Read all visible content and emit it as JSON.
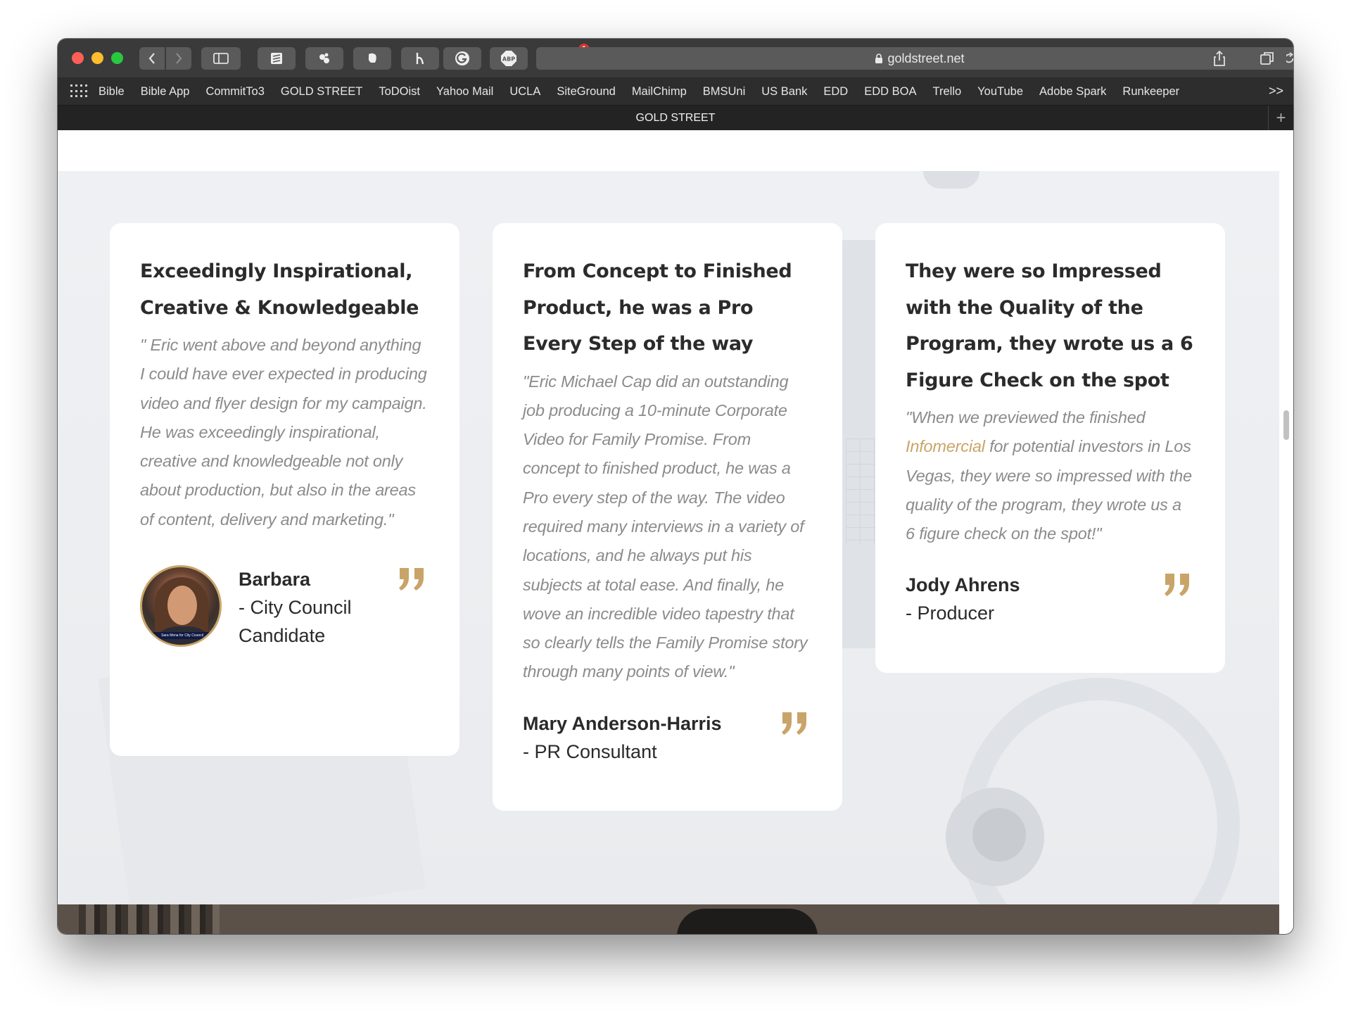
{
  "browser": {
    "url": "goldstreet.net",
    "tab_title": "GOLD STREET",
    "adblock_count": "1",
    "bookmarks": [
      "Bible",
      "Bible App",
      "CommitTo3",
      "GOLD STREET",
      "ToDOist",
      "Yahoo Mail",
      "UCLA",
      "SiteGround",
      "MailChimp",
      "BMSUni",
      "US Bank",
      "EDD",
      "EDD BOA",
      "Trello",
      "YouTube",
      "Adobe Spark",
      "Runkeeper"
    ],
    "more_label": ">>",
    "new_tab_label": "+"
  },
  "testimonials": [
    {
      "title": "Exceedingly Inspirational, Creative & Knowledgeable",
      "quote": "\" Eric went above and beyond anything I could have ever expected in producing video and flyer design for my campaign. He was exceedingly inspirational, creative and knowledgeable not only about production, but also in the areas of content, delivery and marketing.\"",
      "name": "Barbara",
      "role": "- City Council Candidate",
      "avatar_caption": "Sara Mena for City Council"
    },
    {
      "title": "From Concept to Finished Product, he was a Pro Every Step of the way",
      "quote": "\"Eric Michael Cap did an outstanding job producing a 10-minute Corporate Video for Family Promise. From concept to finished product, he was a Pro every step of the way. The video required many interviews in a variety of locations, and he always put his subjects at total ease. And finally, he wove an incredible video tapestry that so clearly tells the Family Promise story through many points of view.\"",
      "name": "Mary Anderson-Harris",
      "role": "- PR Consultant"
    },
    {
      "title": "They were so Impressed with the Quality of the Program, they wrote us a 6 Figure Check on the spot",
      "quote_before": "\"When we previewed the finished ",
      "quote_link": "Infomercial",
      "quote_after": " for potential investors in Los Vegas, they were so impressed with the quality of the program, they wrote us a 6 figure check on the spot!\"",
      "name": "Jody Ahrens",
      "role": "- Producer"
    }
  ],
  "colors": {
    "accent_gold": "#c9a468",
    "text_dark": "#2b2b2b",
    "quote_grey": "#8b8b8b"
  }
}
